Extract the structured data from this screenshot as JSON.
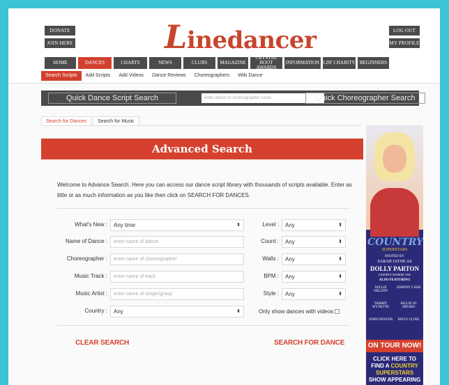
{
  "header": {
    "donate": "DONATE",
    "join": "JOIN HERE",
    "logout": "LOG OUT",
    "profile": "MY PROFILE",
    "logo_initial": "L",
    "logo_rest": "inedancer"
  },
  "nav": [
    "HOME",
    "DANCES",
    "CHARTS",
    "NEWS",
    "CLUBS",
    "MAGAZINE",
    "CRYSTAL BOOT AWARDS",
    "INFORMATION",
    "LDF CHARITY",
    "BEGINNERS"
  ],
  "subnav": [
    "Search Scripts",
    "Add Scripts",
    "Add Videos",
    "Dance Reviews",
    "Choreographers",
    "Wiki Dance"
  ],
  "quick": {
    "script_label": "Quick Dance Script Search",
    "placeholder": "enter dance or choreographer name",
    "choreo_label": "Quick Choreographer Search"
  },
  "tabs": [
    "Search for Dances",
    "Search for Music"
  ],
  "banner": "Advanced Search",
  "intro": "Welcome to Advance Search. Here you can access our dance script library with thousands of scripts available. Enter as little or as much information as you like then click on SEARCH FOR DANCES.",
  "form": {
    "whats_new_label": "What's New :",
    "whats_new_value": "Any time",
    "name_label": "Name of Dance :",
    "name_placeholder": "enter name of dance",
    "choreo_label": "Choreographer :",
    "choreo_placeholder": "enter name of choreographer",
    "track_label": "Music Track :",
    "track_placeholder": "enter name of track",
    "artist_label": "Music Artist :",
    "artist_placeholder": "enter name of singer/group",
    "country_label": "Country :",
    "country_value": "Any",
    "level_label": "Level :",
    "level_value": "Any",
    "count_label": "Count :",
    "count_value": "Any",
    "walls_label": "Walls :",
    "walls_value": "Any",
    "bpm_label": "BPM :",
    "bpm_value": "Any",
    "style_label": "Style :",
    "style_value": "Any",
    "videos_label": "Only show dances with videos"
  },
  "actions": {
    "clear": "CLEAR SEARCH",
    "search": "SEARCH FOR DANCE"
  },
  "ad": {
    "country": "COUNTRY",
    "superstars": "SUPERSTARS",
    "hosted": "HOSTED BY",
    "sarah": "SARAH JAYNE AS",
    "dolly": "DOLLY PARTON",
    "europe": "EUROPE'S NUMBER ONE",
    "also": "ALSO FEATURING",
    "willie": "WILLIE NELSON",
    "johnny": "JOHNNY CASH",
    "tammy": "TAMMY WYNETTE",
    "billie": "BILLIE JO SPEARS",
    "john": "JOHN DENVER",
    "patsy": "PATSY CLINE",
    "tour": "ON TOUR NOW!",
    "click1": "CLICK HERE TO",
    "click2a": "FIND A",
    "click2b": "COUNTRY",
    "click3": "SUPERSTARS",
    "click4": "SHOW APPEARING"
  }
}
